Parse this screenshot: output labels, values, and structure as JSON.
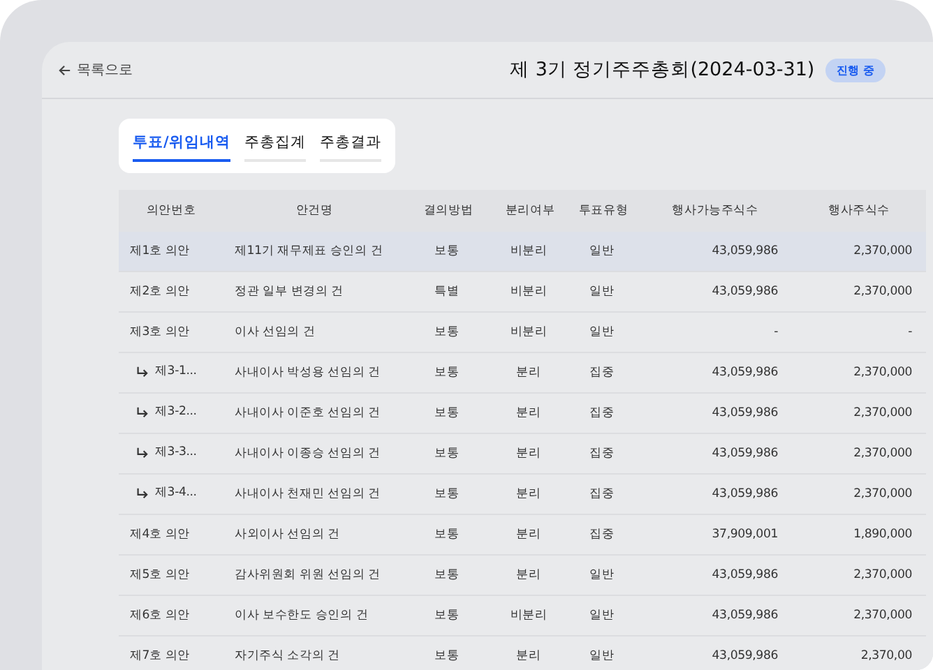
{
  "header": {
    "back_link": "목록으로",
    "title": "제 3기 정기주주총회(2024-03-31)",
    "status_badge": "진행 중"
  },
  "tabs": [
    {
      "label": "투표/위임내역",
      "selected": true
    },
    {
      "label": "주총집계",
      "selected": false
    },
    {
      "label": "주총결과",
      "selected": false
    }
  ],
  "table": {
    "columns": [
      "의안번호",
      "안건명",
      "결의방법",
      "분리여부",
      "투표유형",
      "행사가능주식수",
      "행사주식수"
    ],
    "rows": [
      {
        "kind": "main",
        "selected": true,
        "cells": [
          "제1호 의안",
          "제11기 재무제표 승인의 건",
          "보통",
          "비분리",
          "일반",
          "43,059,986",
          "2,370,000"
        ]
      },
      {
        "kind": "main",
        "selected": false,
        "cells": [
          "제2호 의안",
          "정관 일부 변경의 건",
          "특별",
          "비분리",
          "일반",
          "43,059,986",
          "2,370,000"
        ]
      },
      {
        "kind": "main",
        "selected": false,
        "cells": [
          "제3호 의안",
          "이사 선임의 건",
          "보통",
          "비분리",
          "일반",
          "-",
          "-"
        ]
      },
      {
        "kind": "sub",
        "selected": false,
        "cells": [
          "제3-1...",
          "사내이사 박성용 선임의 건",
          "보통",
          "분리",
          "집중",
          "43,059,986",
          "2,370,000"
        ]
      },
      {
        "kind": "sub",
        "selected": false,
        "cells": [
          "제3-2...",
          "사내이사 이준호 선임의 건",
          "보통",
          "분리",
          "집중",
          "43,059,986",
          "2,370,000"
        ]
      },
      {
        "kind": "sub",
        "selected": false,
        "cells": [
          "제3-3...",
          "사내이사 이종승 선임의 건",
          "보통",
          "분리",
          "집중",
          "43,059,986",
          "2,370,000"
        ]
      },
      {
        "kind": "sub",
        "selected": false,
        "cells": [
          "제3-4...",
          "사내이사 천재민 선임의 건",
          "보통",
          "분리",
          "집중",
          "43,059,986",
          "2,370,000"
        ]
      },
      {
        "kind": "main",
        "selected": false,
        "cells": [
          "제4호 의안",
          "사외이사 선임의 건",
          "보통",
          "분리",
          "집중",
          "37,909,001",
          "1,890,000"
        ]
      },
      {
        "kind": "main",
        "selected": false,
        "cells": [
          "제5호 의안",
          "감사위원회 위원 선임의 건",
          "보통",
          "분리",
          "일반",
          "43,059,986",
          "2,370,000"
        ]
      },
      {
        "kind": "main",
        "selected": false,
        "cells": [
          "제6호 의안",
          "이사 보수한도 승인의 건",
          "보통",
          "비분리",
          "일반",
          "43,059,986",
          "2,370,000"
        ]
      },
      {
        "kind": "main",
        "selected": false,
        "cells": [
          "제7호 의안",
          "자기주식 소각의 건",
          "보통",
          "분리",
          "일반",
          "43,059,986",
          "2,370,00"
        ]
      }
    ]
  }
}
